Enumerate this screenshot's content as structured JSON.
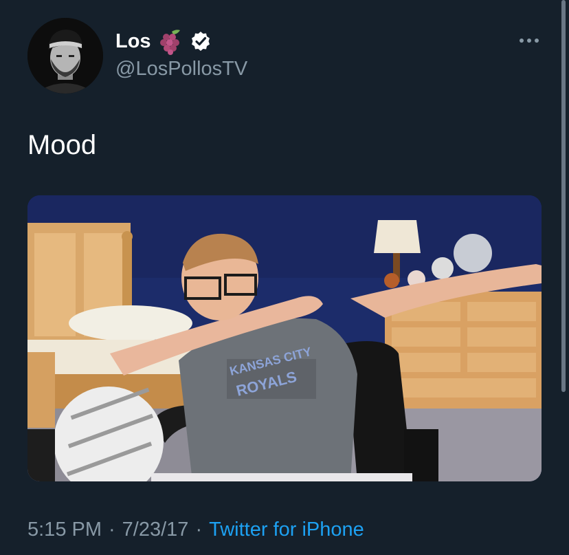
{
  "tweet": {
    "display_name": "Los",
    "name_emoji": "grapes-emoji",
    "verified_icon": "verified-badge-icon",
    "handle": "@LosPollosTV",
    "text": "Mood",
    "more_icon": "more-horizontal-icon",
    "time": "5:15 PM",
    "separator": "·",
    "date": "7/23/17",
    "source": "Twitter for iPhone"
  },
  "colors": {
    "background": "#15202b",
    "primary_text": "#ffffff",
    "secondary_text": "#8899a6",
    "link": "#1da1f2"
  }
}
